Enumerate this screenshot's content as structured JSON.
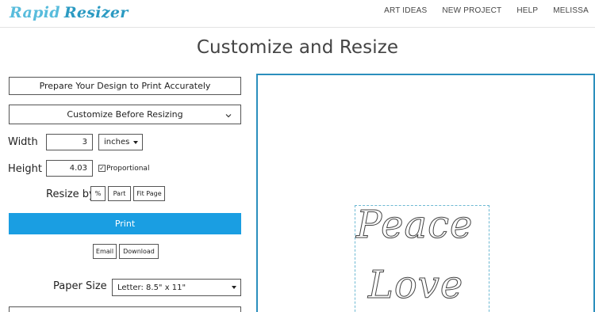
{
  "header": {
    "logo_word1": "Rapid",
    "logo_word2": "Resizer",
    "nav": [
      "ART IDEAS",
      "NEW PROJECT",
      "HELP",
      "MELISSA"
    ]
  },
  "page": {
    "title": "Customize and Resize"
  },
  "panel": {
    "prepare_button": "Prepare Your Design to Print Accurately",
    "customize_button": "Customize Before Resizing",
    "width_label": "Width",
    "width_value": "3",
    "unit_selected": "inches",
    "height_label": "Height",
    "height_value": "4.03",
    "proportional_label": "Proportional",
    "proportional_checked": true,
    "resize_by_label": "Resize by",
    "resize_options": [
      "%",
      "Part",
      "Fit Page"
    ],
    "print_button": "Print",
    "email_button": "Email",
    "download_button": "Download",
    "paper_size_label": "Paper Size",
    "paper_size_value": "Letter: 8.5\" x 11\""
  },
  "preview": {
    "line1": "Peace",
    "line2": "Love"
  },
  "colors": {
    "accent": "#1a9ee2",
    "preview_border": "#2b8fbd",
    "logo": "#2ea6cf"
  }
}
